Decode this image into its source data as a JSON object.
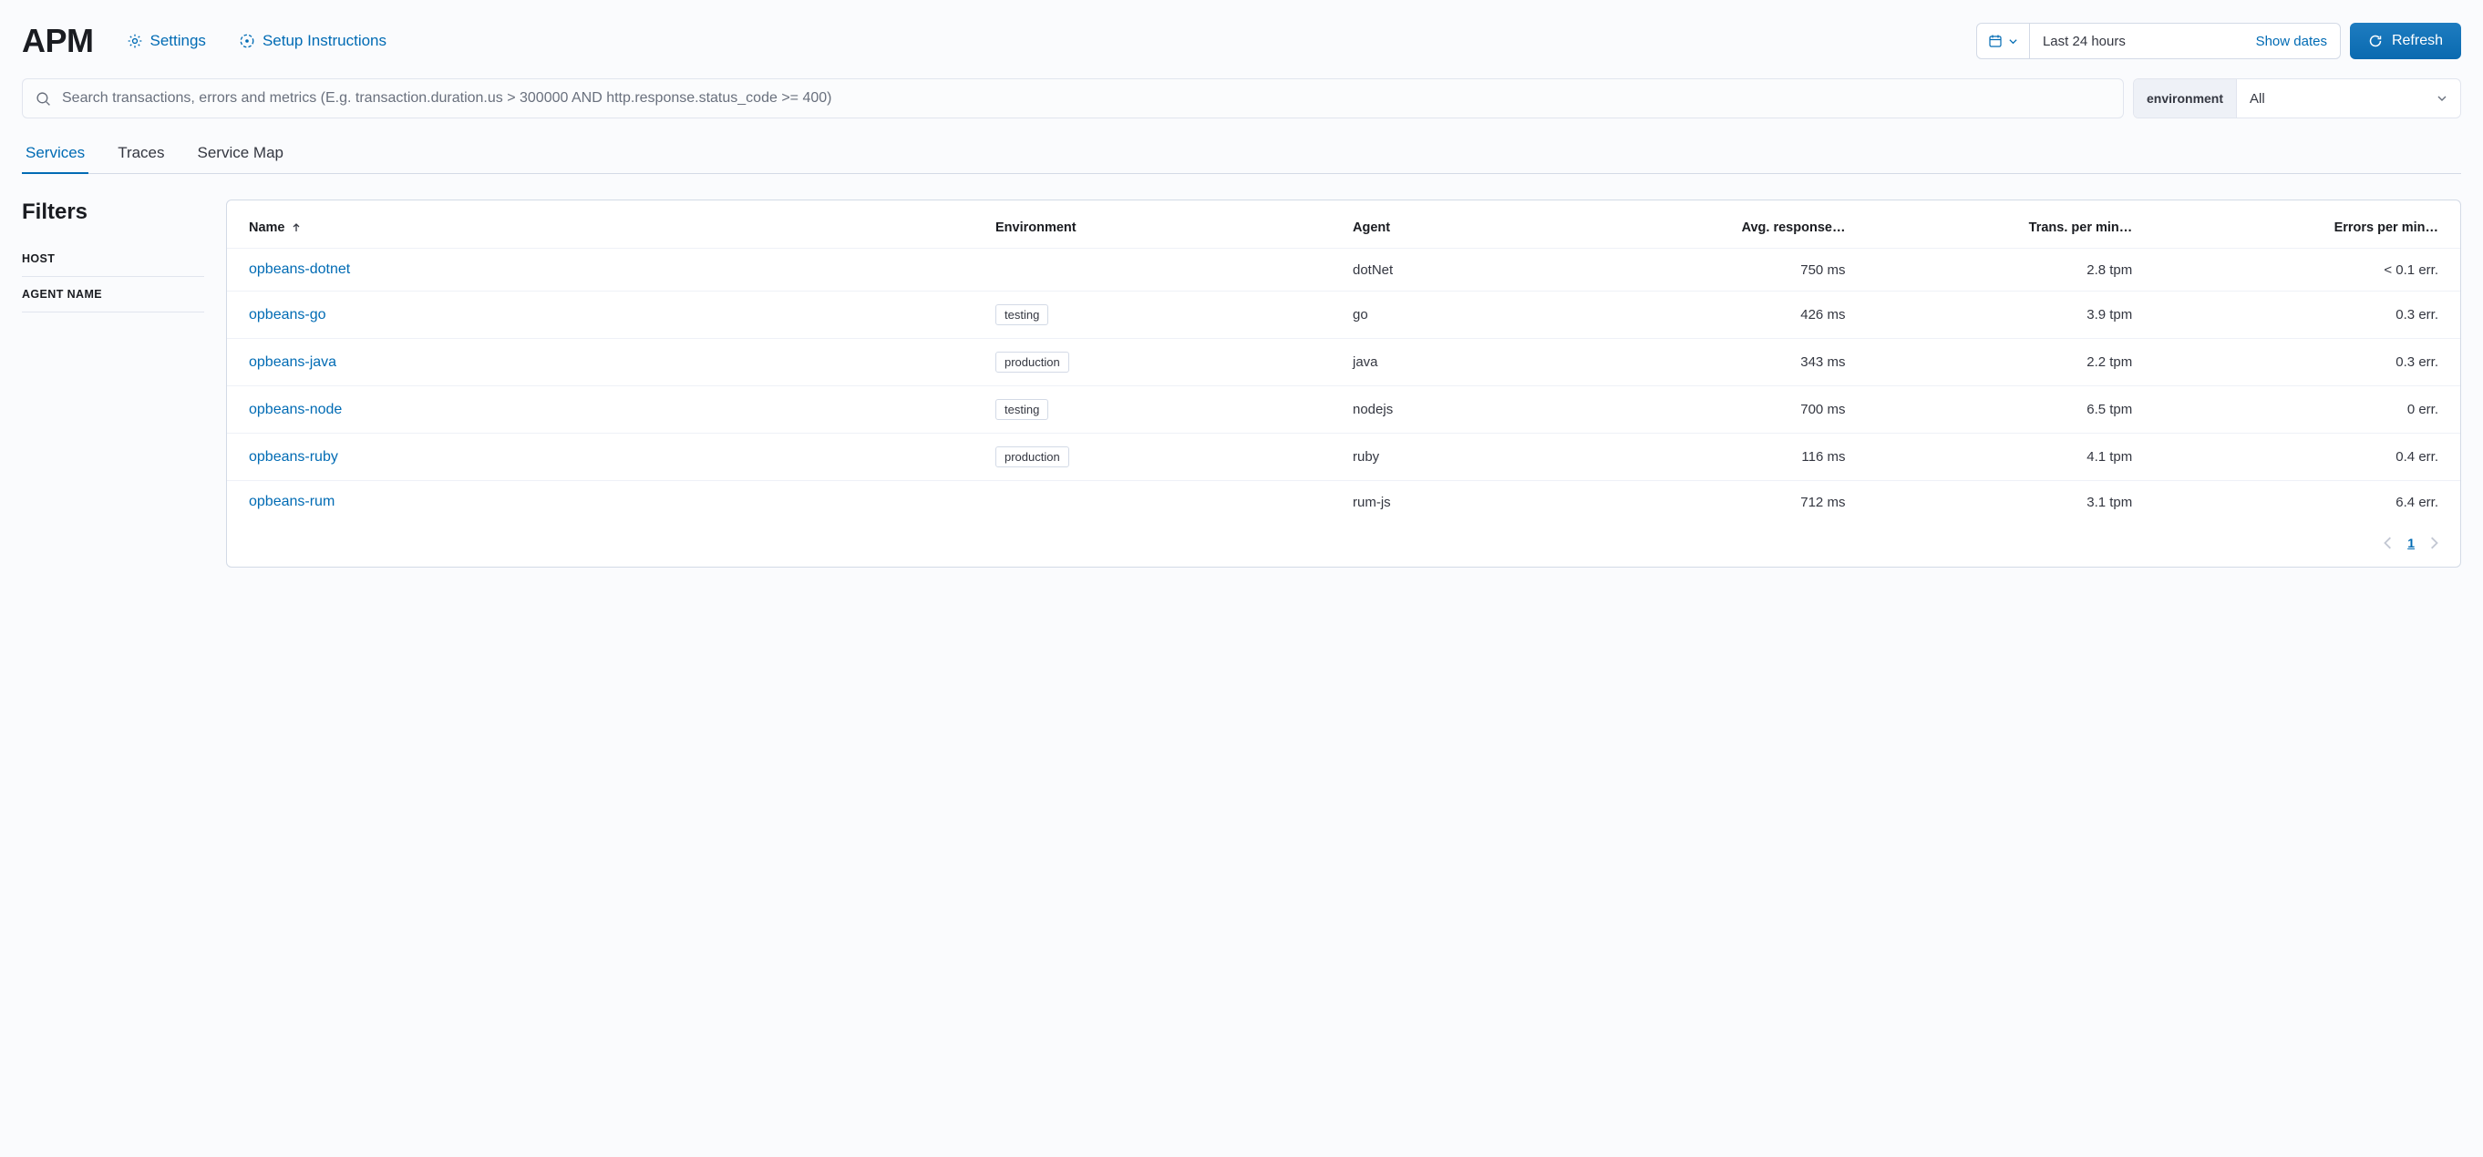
{
  "header": {
    "title": "APM",
    "settings": "Settings",
    "setup": "Setup Instructions",
    "date_range": "Last 24 hours",
    "show_dates": "Show dates",
    "refresh": "Refresh"
  },
  "search": {
    "placeholder": "Search transactions, errors and metrics (E.g. transaction.duration.us > 300000 AND http.response.status_code >= 400)"
  },
  "env_filter": {
    "label": "environment",
    "value": "All"
  },
  "tabs": [
    {
      "id": "services",
      "label": "Services",
      "active": true
    },
    {
      "id": "traces",
      "label": "Traces",
      "active": false
    },
    {
      "id": "service-map",
      "label": "Service Map",
      "active": false
    }
  ],
  "filters": {
    "title": "Filters",
    "items": [
      "HOST",
      "AGENT NAME"
    ]
  },
  "table": {
    "columns": {
      "name": "Name",
      "environment": "Environment",
      "agent": "Agent",
      "avg_response": "Avg. response…",
      "trans_per_min": "Trans. per min…",
      "errors_per_min": "Errors per min…"
    },
    "rows": [
      {
        "name": "opbeans-dotnet",
        "environment": "",
        "agent": "dotNet",
        "avg_response": "750 ms",
        "tpm": "2.8 tpm",
        "errors": "< 0.1 err."
      },
      {
        "name": "opbeans-go",
        "environment": "testing",
        "agent": "go",
        "avg_response": "426 ms",
        "tpm": "3.9 tpm",
        "errors": "0.3 err."
      },
      {
        "name": "opbeans-java",
        "environment": "production",
        "agent": "java",
        "avg_response": "343 ms",
        "tpm": "2.2 tpm",
        "errors": "0.3 err."
      },
      {
        "name": "opbeans-node",
        "environment": "testing",
        "agent": "nodejs",
        "avg_response": "700 ms",
        "tpm": "6.5 tpm",
        "errors": "0 err."
      },
      {
        "name": "opbeans-ruby",
        "environment": "production",
        "agent": "ruby",
        "avg_response": "116 ms",
        "tpm": "4.1 tpm",
        "errors": "0.4 err."
      },
      {
        "name": "opbeans-rum",
        "environment": "",
        "agent": "rum-js",
        "avg_response": "712 ms",
        "tpm": "3.1 tpm",
        "errors": "6.4 err."
      }
    ]
  },
  "pagination": {
    "current": "1"
  }
}
